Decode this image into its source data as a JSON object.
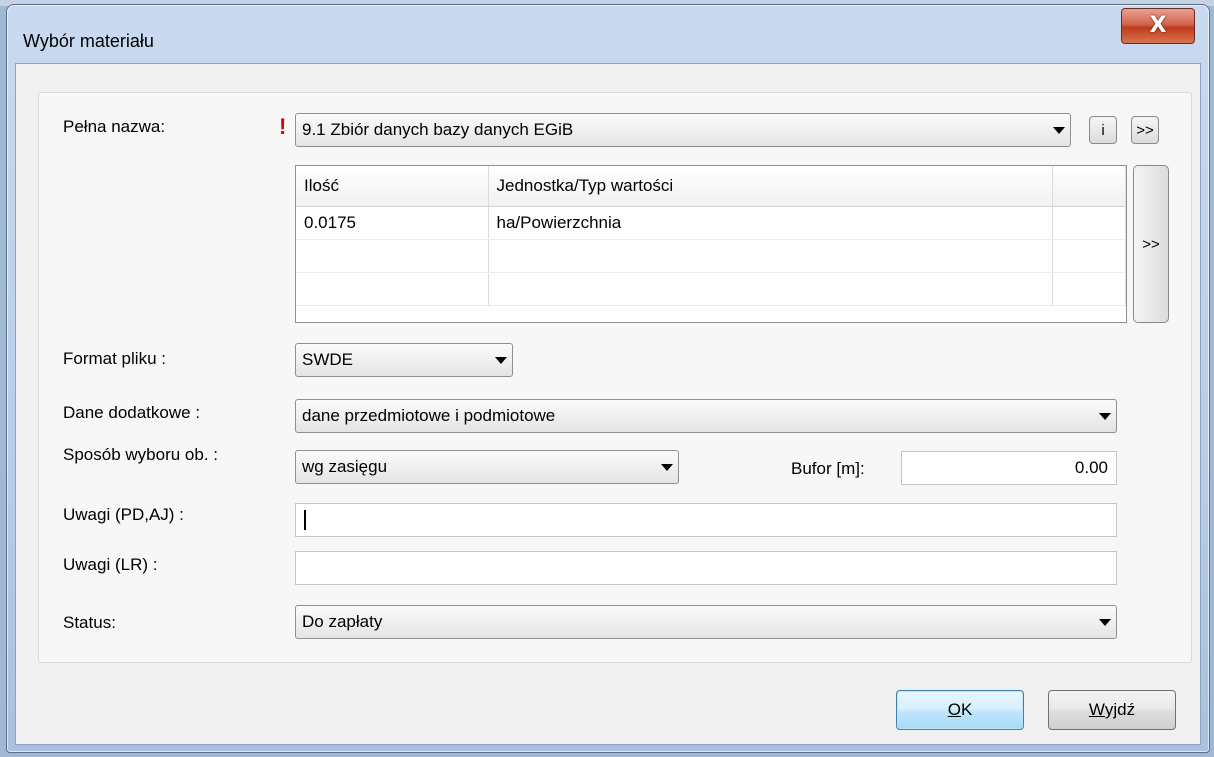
{
  "window": {
    "title": "Wybór materiału",
    "close_glyph": "X"
  },
  "form": {
    "full_name_label": "Pełna nazwa:",
    "full_name_value": "9.1 Zbiór danych bazy danych EGiB",
    "required_mark": "!",
    "info_button": "i",
    "expand_button": ">>",
    "grid_expand_button": ">>",
    "grid": {
      "columns": [
        "Ilość",
        "Jednostka/Typ wartości",
        ""
      ],
      "rows": [
        [
          "0.0175",
          "ha/Powierzchnia",
          ""
        ],
        [
          "",
          "",
          ""
        ],
        [
          "",
          "",
          ""
        ]
      ]
    },
    "file_format_label": "Format pliku :",
    "file_format_value": "SWDE",
    "extra_data_label": "Dane dodatkowe :",
    "extra_data_value": "dane przedmiotowe i podmiotowe",
    "selection_method_label": "Sposób wyboru ob. :",
    "selection_method_value": "wg zasięgu",
    "buffer_label": "Bufor [m]:",
    "buffer_value": "0.00",
    "notes_pd_label": "Uwagi (PD,AJ) :",
    "notes_pd_value": "",
    "notes_lr_label": "Uwagi (LR) :",
    "notes_lr_value": "",
    "status_label": "Status:",
    "status_value": "Do zapłaty"
  },
  "buttons": {
    "ok_underlined": "O",
    "ok_rest": "K",
    "exit_underlined": "W",
    "exit_rest": "yjdź"
  },
  "colors": {
    "required_mark": "#e00000",
    "close_button": "#c03b1f",
    "default_button_border": "#3c7fb1"
  }
}
